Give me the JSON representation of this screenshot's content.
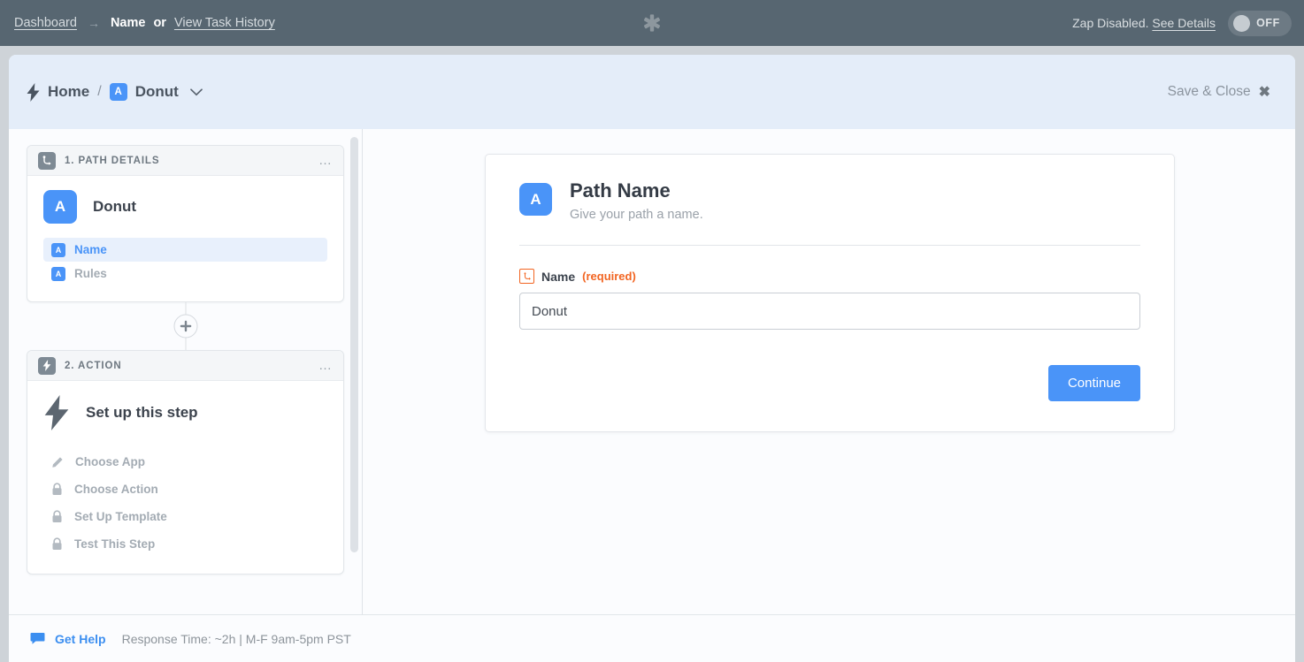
{
  "topbar": {
    "dashboard_link": "Dashboard",
    "arrow": "→",
    "zap_name": "Name",
    "or": "or",
    "task_history_link": "View Task History",
    "logo_icon": "zapier-asterisk-icon",
    "zap_status_prefix": "Zap Disabled.",
    "see_details_link": "See Details",
    "toggle_label": "OFF",
    "toggle_state": "off"
  },
  "panel_header": {
    "bolt_icon": "lightning-bolt-icon",
    "home_label": "Home",
    "separator": "/",
    "step_badge": "A",
    "step_name": "Donut",
    "chevron_icon": "chevron-down-icon",
    "save_close_label": "Save & Close",
    "close_icon": "close-x-icon"
  },
  "sidebar": {
    "steps": [
      {
        "header_icon": "path-branch-icon",
        "header_label": "1. PATH DETAILS",
        "menu_icon": "ellipsis-icon",
        "app_badge": "A",
        "app_name": "Donut",
        "substeps": [
          {
            "badge": "A",
            "label": "Name",
            "state": "active"
          },
          {
            "badge": "A",
            "label": "Rules",
            "state": "idle"
          }
        ]
      },
      {
        "header_icon": "lightning-bolt-icon",
        "header_label": "2. ACTION",
        "menu_icon": "ellipsis-icon",
        "setup_icon": "lightning-bolt-icon",
        "setup_title": "Set up this step",
        "tasks": [
          {
            "icon": "pencil-icon",
            "label": "Choose App"
          },
          {
            "icon": "lock-icon",
            "label": "Choose Action"
          },
          {
            "icon": "lock-icon",
            "label": "Set Up Template"
          },
          {
            "icon": "lock-icon",
            "label": "Test This Step"
          }
        ]
      }
    ],
    "add_step_icon": "plus-icon"
  },
  "main": {
    "badge": "A",
    "title": "Path Name",
    "subtitle": "Give your path a name.",
    "field": {
      "icon": "path-branch-icon",
      "label": "Name",
      "required_text": "(required)",
      "value": "Donut",
      "placeholder": ""
    },
    "continue_label": "Continue"
  },
  "footer": {
    "help_icon": "chat-bubble-icon",
    "help_label": "Get Help",
    "response_time": "Response Time: ~2h | M-F 9am-5pm PST"
  },
  "colors": {
    "topbar_bg": "#576671",
    "panel_header_bg": "#e4edf9",
    "accent_blue": "#4a94f8",
    "required_orange": "#f26522",
    "muted_gray": "#a3abb3"
  }
}
